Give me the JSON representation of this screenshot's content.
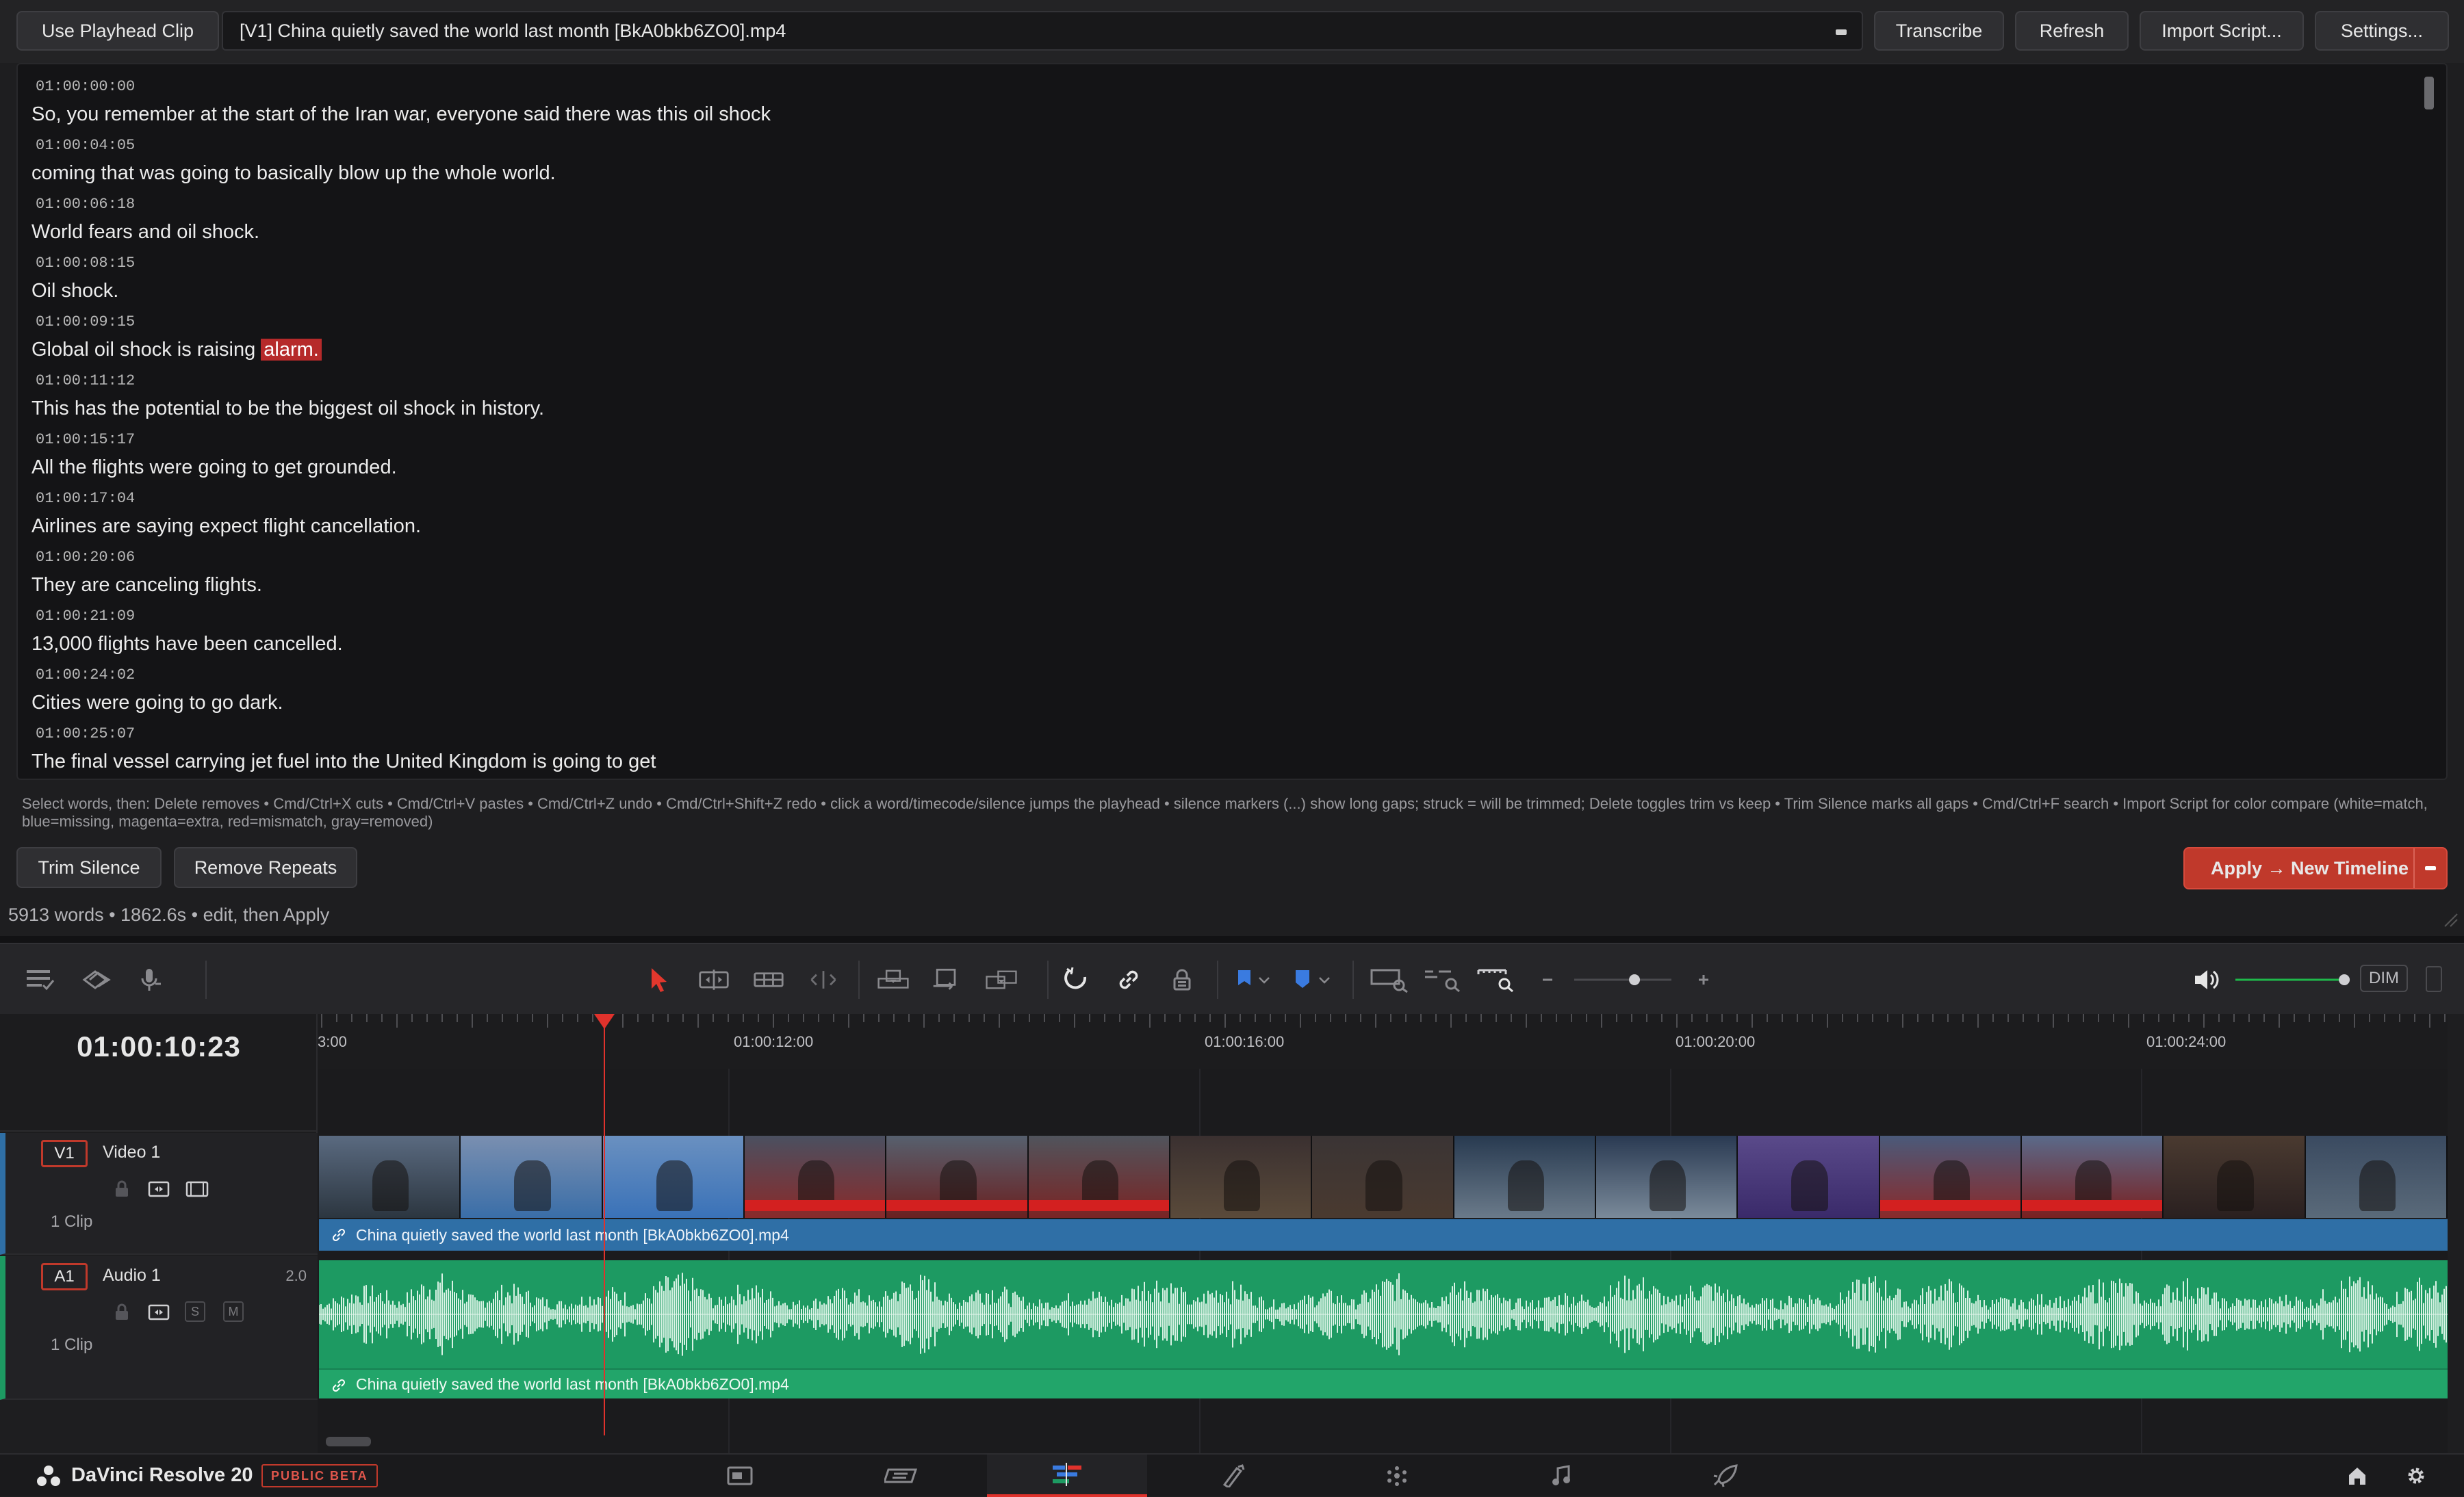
{
  "topbar": {
    "use_playhead_label": "Use Playhead Clip",
    "clip_value": "[V1] China quietly saved the world last month [BkA0bkb6ZO0].mp4",
    "transcribe_label": "Transcribe",
    "refresh_label": "Refresh",
    "import_label": "Import Script...",
    "settings_label": "Settings..."
  },
  "transcript": {
    "entries": [
      {
        "tc": "01:00:00:00",
        "text": "So, you remember at the start of the Iran war, everyone said there was this oil shock"
      },
      {
        "tc": "01:00:04:05",
        "text": "coming that was going to basically blow up the whole world."
      },
      {
        "tc": "01:00:06:18",
        "text": "World fears and oil shock."
      },
      {
        "tc": "01:00:08:15",
        "text": "Oil shock."
      },
      {
        "tc": "01:00:09:15",
        "text_before": "Global oil shock is raising ",
        "text_highlight": "alarm."
      },
      {
        "tc": "01:00:11:12",
        "text": "This has the potential to be the biggest oil shock in history."
      },
      {
        "tc": "01:00:15:17",
        "text": "All the flights were going to get grounded."
      },
      {
        "tc": "01:00:17:04",
        "text": "Airlines are saying expect flight cancellation."
      },
      {
        "tc": "01:00:20:06",
        "text": "They are canceling flights."
      },
      {
        "tc": "01:00:21:09",
        "text": "13,000 flights have been cancelled."
      },
      {
        "tc": "01:00:24:02",
        "text": "Cities were going to go dark."
      },
      {
        "tc": "01:00:25:07",
        "text": "The final vessel carrying jet fuel into the United Kingdom is going to get"
      }
    ]
  },
  "help_text": "Select words, then: Delete removes • Cmd/Ctrl+X cuts • Cmd/Ctrl+V pastes • Cmd/Ctrl+Z undo • Cmd/Ctrl+Shift+Z redo • click a word/timecode/silence jumps the playhead • silence markers (...) show long gaps; struck = will be trimmed; Delete toggles trim vs keep • Trim Silence marks all gaps • Cmd/Ctrl+F search • Import Script for color compare (white=match, blue=missing, magenta=extra, red=mismatch, gray=removed)",
  "actions": {
    "trim_silence_label": "Trim Silence",
    "remove_repeats_label": "Remove Repeats",
    "apply_label": "Apply → New Timeline"
  },
  "status_text": "5913 words • 1862.6s • edit, then Apply",
  "timeline": {
    "timecode": "01:00:10:23",
    "ruler_labels": [
      "3:00",
      "01:00:12:00",
      "01:00:16:00",
      "01:00:20:00",
      "01:00:24:00"
    ],
    "dim_label": "DIM",
    "volume_level": 0.97,
    "zoom_level": 0.62,
    "video_track": {
      "id": "V1",
      "name": "Video 1",
      "clips": "1 Clip",
      "clip_name": "China quietly saved the world last month [BkA0bkb6ZO0].mp4"
    },
    "audio_track": {
      "id": "A1",
      "name": "Audio 1",
      "level": "2.0",
      "clips": "1 Clip",
      "solo": "S",
      "mute": "M",
      "clip_name": "China quietly saved the world last month [BkA0bkb6ZO0].mp4"
    }
  },
  "bottombar": {
    "app_name": "DaVinci Resolve 20",
    "badge": "PUBLIC BETA"
  },
  "colors": {
    "accent_red": "#c0392b",
    "video_clip": "#2f6fa6",
    "audio_clip": "#1d9a62",
    "highlight": "#b62a2a"
  }
}
